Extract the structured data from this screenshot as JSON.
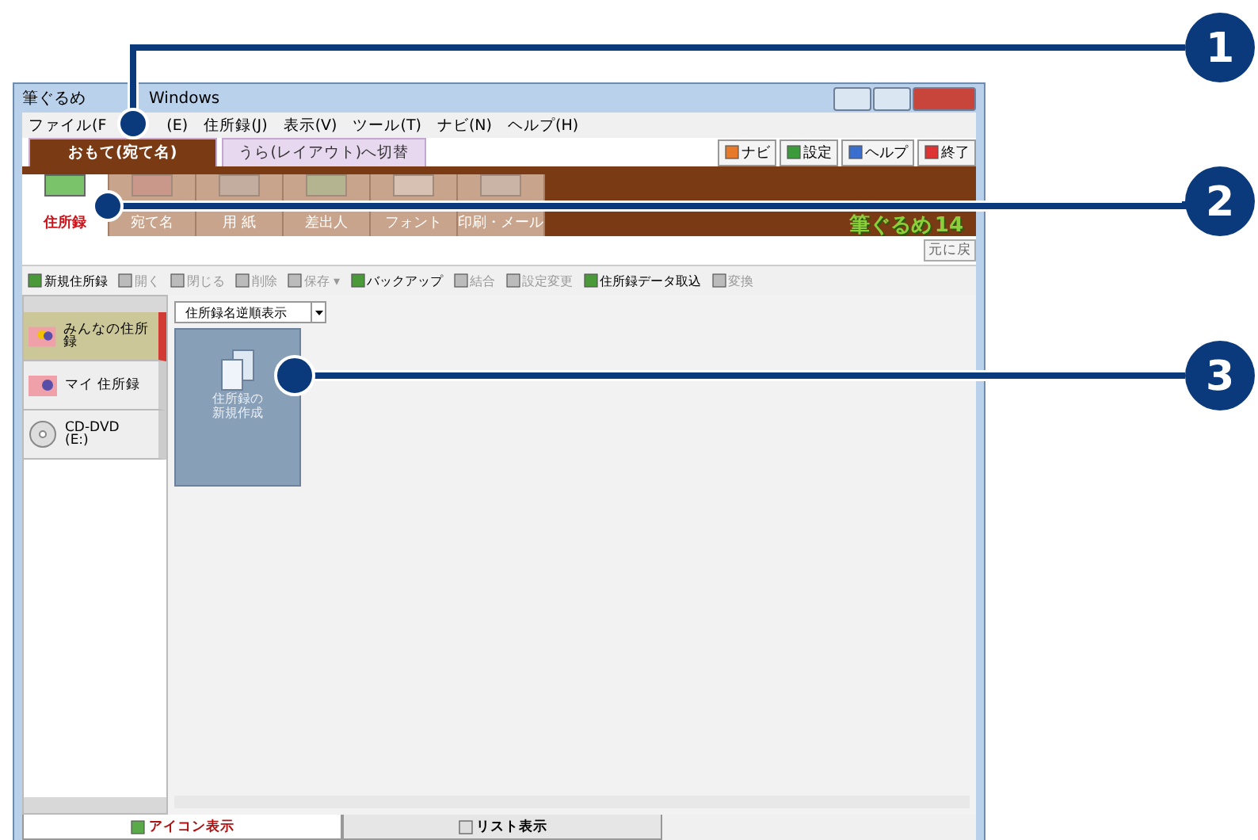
{
  "window": {
    "title_parts": [
      "筆ぐるめ",
      "Windows"
    ]
  },
  "menu": [
    "ファイル(F",
    "(E)",
    "住所録(J)",
    "表示(V)",
    "ツール(T)",
    "ナビ(N)",
    "ヘルプ(H)"
  ],
  "side_tabs": [
    {
      "label": "おもて(宛て名)",
      "selected": true
    },
    {
      "label": "うら(レイアウト)へ切替",
      "selected": false
    }
  ],
  "top_buttons": [
    "ナビ",
    "設定",
    "ヘルプ",
    "終了"
  ],
  "nav": [
    {
      "label": "住所録",
      "selected": true
    },
    {
      "label": "宛て名",
      "selected": false
    },
    {
      "label": "用 紙",
      "selected": false
    },
    {
      "label": "差出人",
      "selected": false
    },
    {
      "label": "フォント",
      "selected": false
    },
    {
      "label": "印刷・メール",
      "selected": false
    }
  ],
  "logo": {
    "name": "筆ぐるめ",
    "version": "14"
  },
  "undo_button": "元に戻",
  "toolbar": [
    {
      "label": "新規住所録",
      "disabled": false
    },
    {
      "label": "開く",
      "disabled": true
    },
    {
      "label": "閉じる",
      "disabled": true
    },
    {
      "label": "削除",
      "disabled": true
    },
    {
      "label": "保存 ▾",
      "disabled": true
    },
    {
      "label": "バックアップ",
      "disabled": false
    },
    {
      "label": "結合",
      "disabled": true
    },
    {
      "label": "設定変更",
      "disabled": true
    },
    {
      "label": "住所録データ取込",
      "disabled": false
    },
    {
      "label": "変換",
      "disabled": true
    }
  ],
  "sidebar": {
    "items": [
      {
        "label": "みんなの住所録",
        "kind": "group",
        "selected": true
      },
      {
        "label": "マイ 住所録",
        "kind": "personal",
        "selected": false
      },
      {
        "label": "CD-DVD\n(E:)",
        "kind": "disc",
        "selected": false
      }
    ]
  },
  "sort_dropdown": "住所録名逆順表示",
  "tiles": [
    {
      "lines": [
        "住所録の",
        "新規作成"
      ]
    }
  ],
  "view_tabs": [
    {
      "label": "アイコン表示",
      "selected": true
    },
    {
      "label": "リスト表示",
      "selected": false
    }
  ],
  "callouts": [
    {
      "number": "1"
    },
    {
      "number": "2"
    },
    {
      "number": "3"
    }
  ]
}
